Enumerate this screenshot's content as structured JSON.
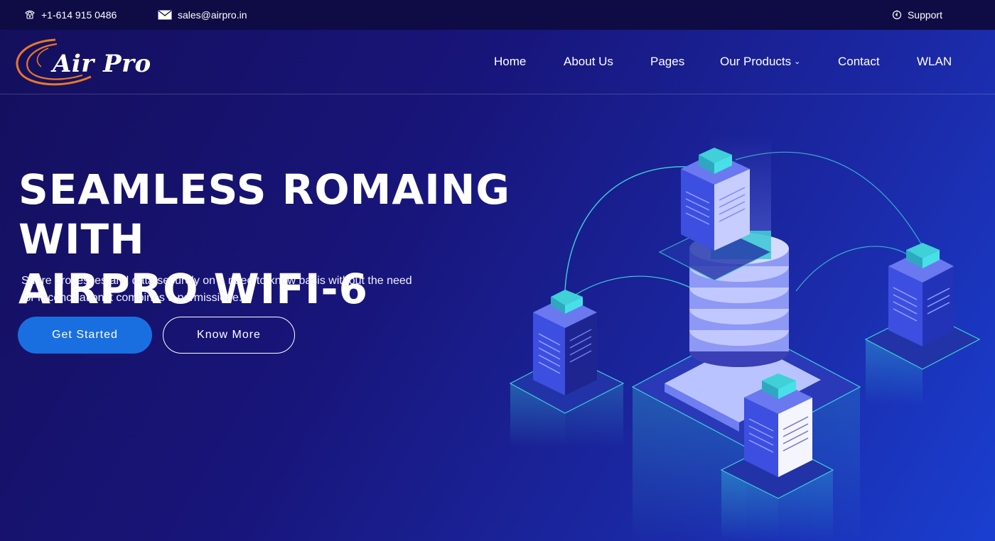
{
  "topbar": {
    "phone": "+1-614 915 0486",
    "email": "sales@airpro.in",
    "support": "Support",
    "phone_icon": "phone-icon",
    "email_icon": "envelope-icon",
    "support_icon": "support-icon"
  },
  "brand": {
    "logo_text": "Air Pro",
    "logo_swoosh_color": "#e8772a"
  },
  "nav": {
    "items": [
      {
        "label": "Home"
      },
      {
        "label": "About Us"
      },
      {
        "label": "Pages"
      },
      {
        "label": "Our Products"
      },
      {
        "label": "Contact"
      },
      {
        "label": "WLAN"
      }
    ],
    "dropdown_icon": "chevron-down-icon"
  },
  "hero": {
    "title_line1": "SEAMLESS ROMAING WITH",
    "title_line2": "AIRPRO WIFI-6",
    "description_line1": "Share processes and data securely on a need to know basis without the need",
    "description_line2": "for reconciliation it combines a permissione.",
    "primary_button": "Get Started",
    "secondary_button": "Know More",
    "illustration": "isometric-server-network-illustration"
  },
  "colors": {
    "topbar_bg": "#0f0b45",
    "primary_button": "#1a6fe0",
    "accent_cyan": "#3fd0d8",
    "server_blue": "#3b4fd9"
  }
}
